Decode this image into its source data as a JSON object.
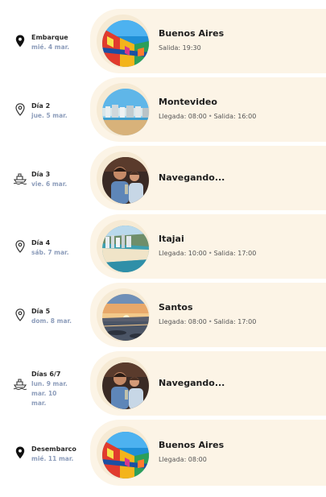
{
  "itinerary": [
    {
      "label": "Embarque",
      "date": "mié. 4 mar.",
      "icon": "map-pin-filled-icon",
      "port": "Buenos Aires",
      "times": [
        "Salida: 19:30"
      ],
      "photo": "caminito-houses"
    },
    {
      "label": "Día 2",
      "date": "jue. 5 mar.",
      "icon": "map-pin-outline-icon",
      "port": "Montevideo",
      "times": [
        "Llegada: 08:00",
        "Salida: 16:00"
      ],
      "photo": "montevideo-beach"
    },
    {
      "label": "Día 3",
      "date": "vie. 6 mar.",
      "icon": "ship-icon",
      "port": "Navegando...",
      "times": [],
      "photo": "onboard-guests"
    },
    {
      "label": "Día 4",
      "date": "sáb. 7 mar.",
      "icon": "map-pin-outline-icon",
      "port": "Itajai",
      "times": [
        "Llegada: 10:00",
        "Salida: 17:00"
      ],
      "photo": "itajai-coast"
    },
    {
      "label": "Día 5",
      "date": "dom. 8 mar.",
      "icon": "map-pin-outline-icon",
      "port": "Santos",
      "times": [
        "Llegada: 08:00",
        "Salida: 17:00"
      ],
      "photo": "santos-sunset"
    },
    {
      "label": "Días 6/7",
      "date": "lun. 9 mar. mar. 10 mar.",
      "icon": "ship-icon",
      "port": "Navegando...",
      "times": [],
      "photo": "onboard-guests"
    },
    {
      "label": "Desembarco",
      "date": "mié. 11 mar.",
      "icon": "map-pin-filled-icon",
      "port": "Buenos Aires",
      "times": [
        "Llegada: 08:00"
      ],
      "photo": "caminito-houses"
    }
  ],
  "colors": {
    "card_bg": "#fcf4e6",
    "date_text": "#8d9dbb",
    "title_text": "#1e1e1e"
  }
}
